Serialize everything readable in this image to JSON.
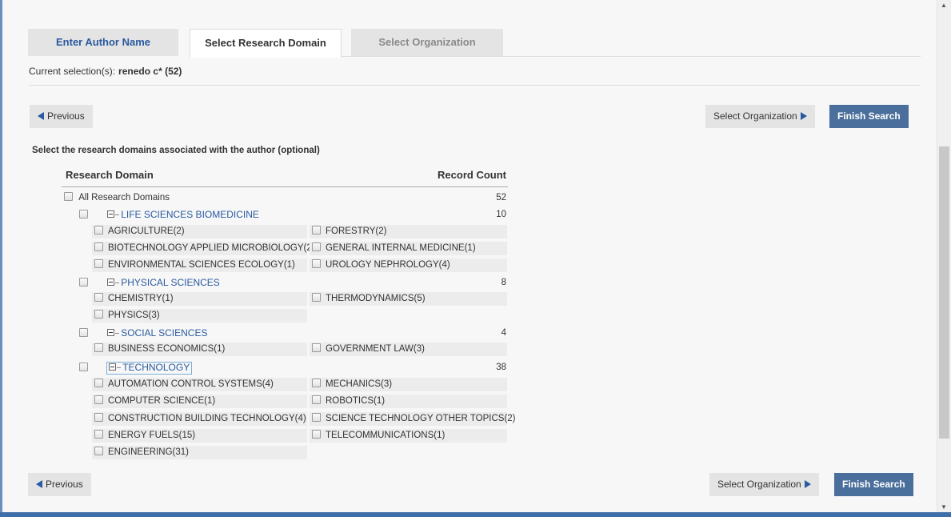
{
  "tabs": {
    "author": "Enter Author Name",
    "domain": "Select Research Domain",
    "organization": "Select Organization"
  },
  "current_selection": {
    "label": "Current selection(s):",
    "value": "renedo c* (52)"
  },
  "buttons": {
    "previous": "Previous",
    "select_organization": "Select Organization",
    "finish_search": "Finish Search"
  },
  "instruction": "Select the research domains associated with the author (optional)",
  "table": {
    "col_domain": "Research Domain",
    "col_count": "Record Count",
    "all": {
      "label": "All Research Domains",
      "count": "52"
    },
    "categories": [
      {
        "label": "LIFE SCIENCES BIOMEDICINE",
        "count": "10",
        "items": [
          "AGRICULTURE(2)",
          "FORESTRY(2)",
          "BIOTECHNOLOGY APPLIED MICROBIOLOGY(2)",
          "GENERAL INTERNAL MEDICINE(1)",
          "ENVIRONMENTAL SCIENCES ECOLOGY(1)",
          "UROLOGY NEPHROLOGY(4)"
        ]
      },
      {
        "label": "PHYSICAL SCIENCES",
        "count": "8",
        "items": [
          "CHEMISTRY(1)",
          "THERMODYNAMICS(5)",
          "PHYSICS(3)"
        ]
      },
      {
        "label": "SOCIAL SCIENCES",
        "count": "4",
        "items": [
          "BUSINESS ECONOMICS(1)",
          "GOVERNMENT LAW(3)"
        ]
      },
      {
        "label": "TECHNOLOGY",
        "count": "38",
        "items": [
          "AUTOMATION CONTROL SYSTEMS(4)",
          "MECHANICS(3)",
          "COMPUTER SCIENCE(1)",
          "ROBOTICS(1)",
          "CONSTRUCTION BUILDING TECHNOLOGY(4)",
          "SCIENCE TECHNOLOGY OTHER TOPICS(2)",
          "ENERGY FUELS(15)",
          "TELECOMMUNICATIONS(1)",
          "ENGINEERING(31)"
        ]
      }
    ]
  }
}
